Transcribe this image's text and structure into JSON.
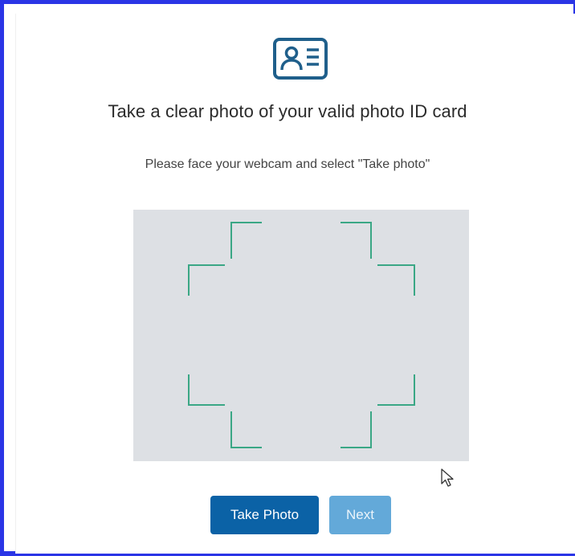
{
  "heading": "Take a clear photo of your valid photo ID card",
  "instruction": "Please face your webcam and select \"Take photo\"",
  "buttons": {
    "take_photo": "Take Photo",
    "next": "Next"
  },
  "icons": {
    "header_icon": "id-card-icon",
    "pointer": "mouse-cursor-icon"
  },
  "colors": {
    "frame_border": "#2a35e6",
    "icon_accent": "#1f5f8b",
    "guide_corners": "#3aa785",
    "camera_bg": "#dde0e4",
    "primary_button": "#0b62a6",
    "disabled_button": "#63a9d9"
  }
}
